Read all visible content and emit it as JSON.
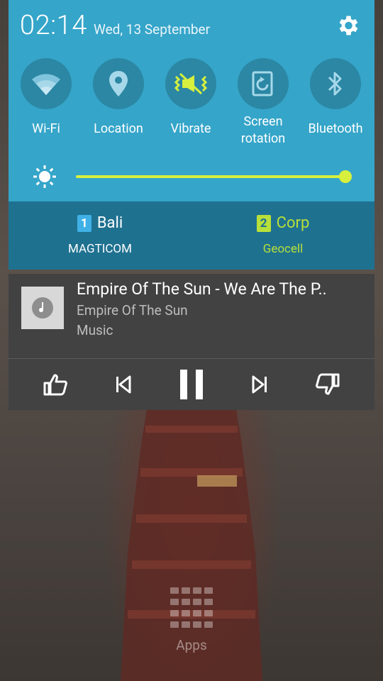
{
  "status": {
    "time": "02:14",
    "date": "Wed, 13 September"
  },
  "quick_settings": [
    {
      "label": "Wi-Fi",
      "icon": "wifi-icon",
      "active": false
    },
    {
      "label": "Location",
      "icon": "location-icon",
      "active": false
    },
    {
      "label": "Vibrate",
      "icon": "vibrate-icon",
      "active": true
    },
    {
      "label": "Screen rotation",
      "icon": "screen-rotation-icon",
      "active": false
    },
    {
      "label": "Bluetooth",
      "icon": "bluetooth-icon",
      "active": false
    }
  ],
  "brightness": {
    "level": 1.0
  },
  "sims": [
    {
      "slot": "1",
      "name": "Bali",
      "carrier": "MAGTICOM",
      "color": "#ffffff",
      "badge_color": "#3fb1e6"
    },
    {
      "slot": "2",
      "name": "Corp",
      "carrier": "Geocell",
      "color": "#b7e03a",
      "badge_color": "#b7e03a"
    }
  ],
  "music": {
    "title": "Empire Of The Sun - We Are The P..",
    "artist": "Empire Of The Sun",
    "app": "Music",
    "controls": [
      "thumbs-up-icon",
      "previous-icon",
      "pause-icon",
      "next-icon",
      "thumbs-down-icon"
    ]
  },
  "home": {
    "apps_label": "Apps"
  },
  "colors": {
    "panel": "#35a5c9",
    "accent": "#d7f03d",
    "sim_bar": "#1f7190",
    "music_bg": "#424242"
  }
}
